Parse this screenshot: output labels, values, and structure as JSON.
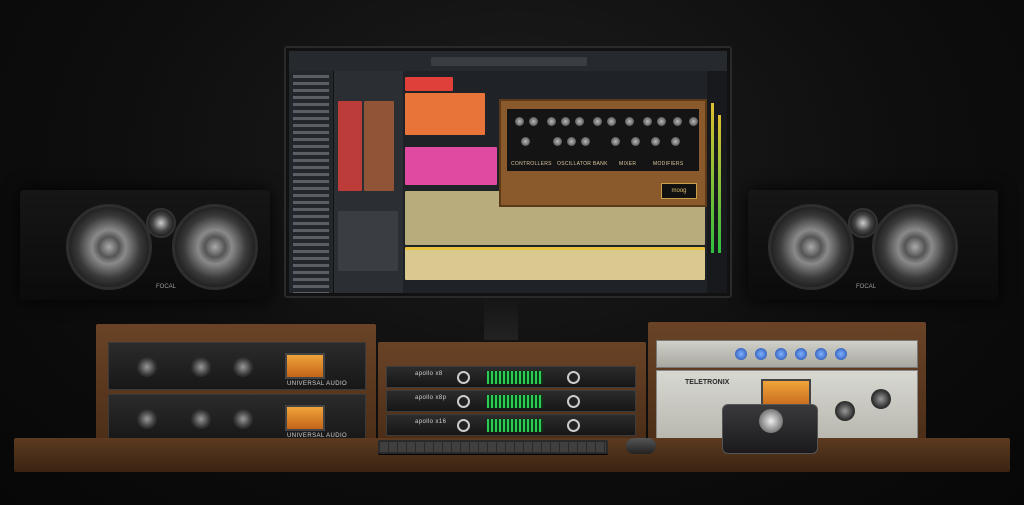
{
  "image": {
    "monitor": {
      "plugin_sections": [
        "CONTROLLERS",
        "OSCILLATOR BANK",
        "MIXER",
        "MODIFIERS"
      ],
      "plugin_brand": "moog"
    },
    "speakers": {
      "brand": "FOCAL"
    },
    "rack_left": {
      "unit_label": "UNIVERSAL AUDIO"
    },
    "apollo_units": [
      "apollo x8",
      "apollo x8p",
      "apollo x16"
    ],
    "compressor": {
      "brand": "TELETRONIX"
    },
    "colors": {
      "clip_red": "#e0403a",
      "clip_orange": "#e8743a",
      "clip_pink": "#e04aa0",
      "clip_yellow": "#e7c23a",
      "wood": "#6a4326",
      "vu_amber": "#f0a43a",
      "meter_green": "#2ecc55"
    }
  }
}
